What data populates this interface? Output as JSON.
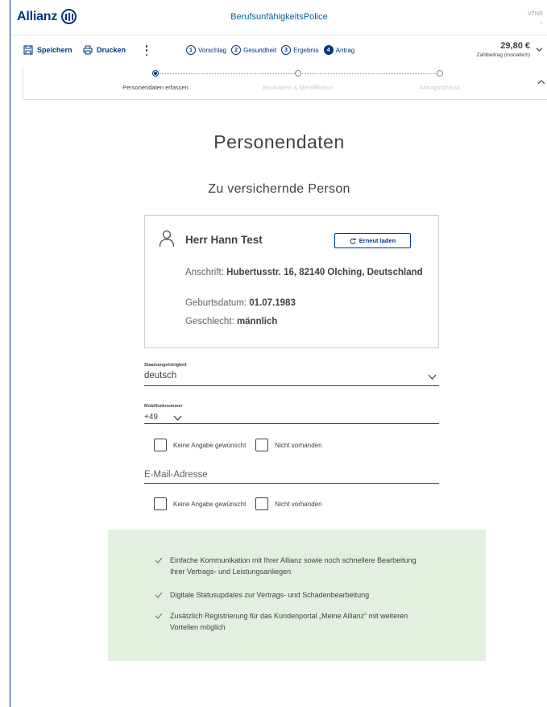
{
  "header": {
    "brand": "Allianz",
    "app_title": "BerufsunfähigkeitsPolice",
    "vtnr_label": "VTNR",
    "vtnr_value": "–"
  },
  "toolbar": {
    "save_label": "Speichern",
    "print_label": "Drucken",
    "steps": [
      {
        "num": "1",
        "label": "Vorschlag"
      },
      {
        "num": "2",
        "label": "Gesundheit"
      },
      {
        "num": "3",
        "label": "Ergebnis"
      },
      {
        "num": "4",
        "label": "Antrag"
      }
    ],
    "price": "29,80 €",
    "price_label": "Zahlbeitrag (monatlich)"
  },
  "subprogress": {
    "steps": [
      "Personendaten erfassen",
      "Bankdaten & Identifikation",
      "Antragsschluss"
    ]
  },
  "main": {
    "title": "Personendaten",
    "subtitle": "Zu versichernde Person",
    "person": {
      "name": "Herr Hann Test",
      "reload_label": "Erneut laden",
      "address_label": "Anschrift:",
      "address_value": "Hubertusstr. 16, 82140 Olching, Deutschland",
      "birth_label": "Geburtsdatum:",
      "birth_value": "01.07.1983",
      "gender_label": "Geschlecht:",
      "gender_value": "männlich"
    },
    "nationality": {
      "label": "Staatsangehörigkeit",
      "value": "deutsch"
    },
    "mobile": {
      "label": "Mobilfunknummer",
      "country_code": "+49"
    },
    "mobile_options": {
      "no_answer": "Keine Angabe gewünscht",
      "not_available": "Nicht vorhanden"
    },
    "email": {
      "placeholder": "E-Mail-Adresse"
    },
    "email_options": {
      "no_answer": "Keine Angabe gewünscht",
      "not_available": "Nicht vorhanden"
    },
    "benefits": [
      "Einfache Kommunikation mit Ihrer Allianz sowie noch schnellere Bearbeitung Ihrer Vertrags- und Leistungsanliegen",
      "Digitale Statusupdates zur Vertrags- und Schadenbearbeitung",
      "Zusätzlich Registrierung für das Kundenportal „Meine Allianz“ mit weiteren Vorteilen möglich"
    ]
  },
  "colors": {
    "brand": "#003781",
    "text": "#414141",
    "benefit_bg": "#e3f0e0"
  }
}
